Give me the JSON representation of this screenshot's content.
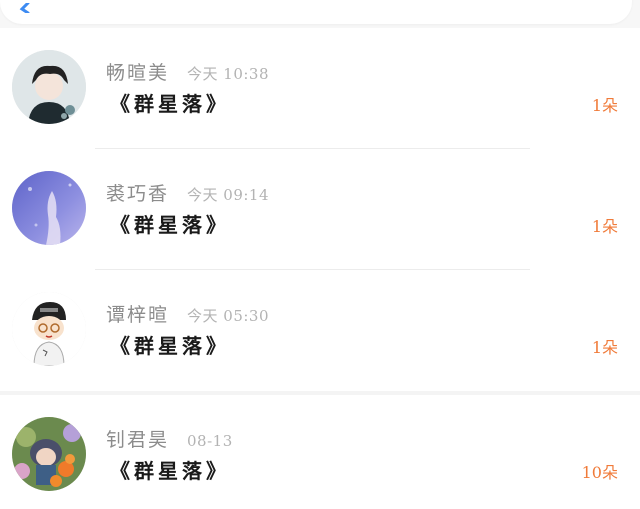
{
  "header": {
    "back_icon": "back-chevron-icon"
  },
  "colors": {
    "accent": "#f07b3a",
    "name_gray": "#8c8c8c",
    "time_gray": "#b3b3b3",
    "title_black": "#1a1a1a"
  },
  "conversations": [
    {
      "name": "畅暄美",
      "time": "今天 10:38",
      "title": "《群星落》",
      "count": "1朵",
      "avatar": "anime-boy-avatar"
    },
    {
      "name": "裘巧香",
      "time": "今天 09:14",
      "title": "《群星落》",
      "count": "1朵",
      "avatar": "purple-sky-avatar"
    },
    {
      "name": "谭梓暄",
      "time": "今天 05:30",
      "title": "《群星落》",
      "count": "1朵",
      "avatar": "cartoon-boy-avatar"
    },
    {
      "name": "钊君昊",
      "time": "08-13",
      "title": "《群星落》",
      "count": "10朵",
      "avatar": "flower-doll-avatar"
    }
  ]
}
